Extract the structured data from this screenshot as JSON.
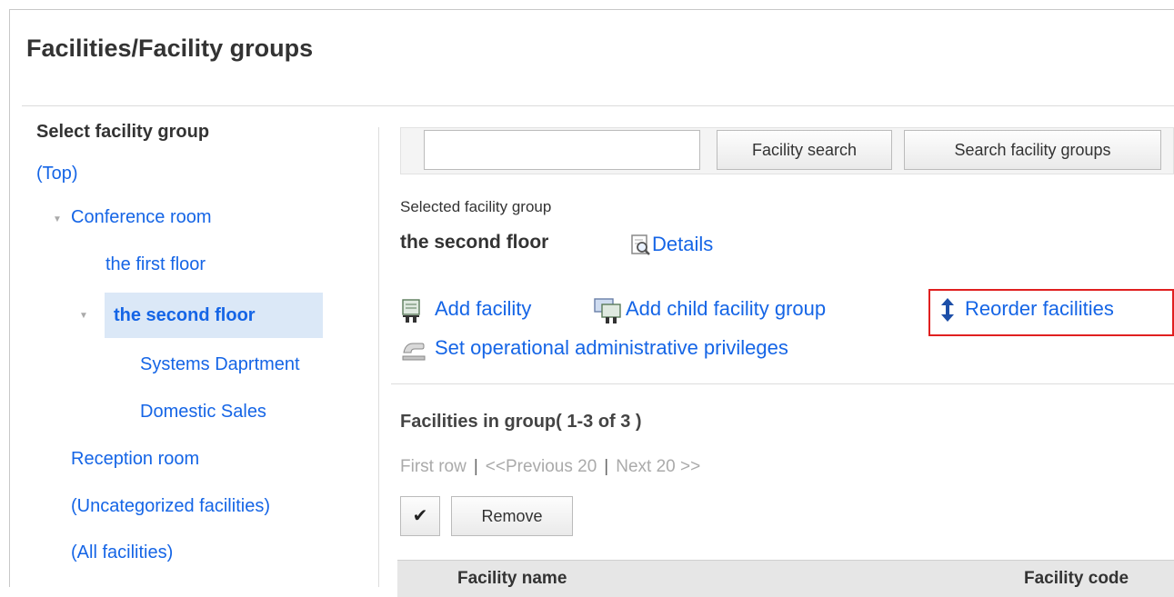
{
  "page": {
    "title": "Facilities/Facility groups"
  },
  "sidebar": {
    "heading": "Select facility group",
    "items": [
      {
        "label": "(Top)"
      },
      {
        "label": "Conference room"
      },
      {
        "label": "the first floor"
      },
      {
        "label": "the second floor",
        "selected": true
      },
      {
        "label": "Systems Daprtment"
      },
      {
        "label": "Domestic Sales"
      },
      {
        "label": "Reception room"
      },
      {
        "label": "(Uncategorized facilities)"
      },
      {
        "label": "(All facilities)"
      }
    ]
  },
  "search": {
    "value": "",
    "facility_button": "Facility search",
    "group_button": "Search facility groups"
  },
  "selected_group": {
    "label": "Selected facility group",
    "name": "the second floor",
    "details_link": "Details"
  },
  "actions": {
    "add_facility": "Add facility",
    "add_child_group": "Add child facility group",
    "reorder": "Reorder facilities",
    "privileges": "Set operational administrative privileges"
  },
  "facilities": {
    "heading": "Facilities in group( 1-3 of 3 )",
    "pager": {
      "first": "First row",
      "prev": "<<Previous 20",
      "next": "Next 20 >>"
    },
    "check_icon": "checkmark-icon",
    "remove_button": "Remove",
    "columns": [
      "Facility name",
      "Facility code"
    ]
  },
  "colors": {
    "link": "#1565e6",
    "selected_bg": "#dbe8f7",
    "highlight": "#e02020"
  }
}
